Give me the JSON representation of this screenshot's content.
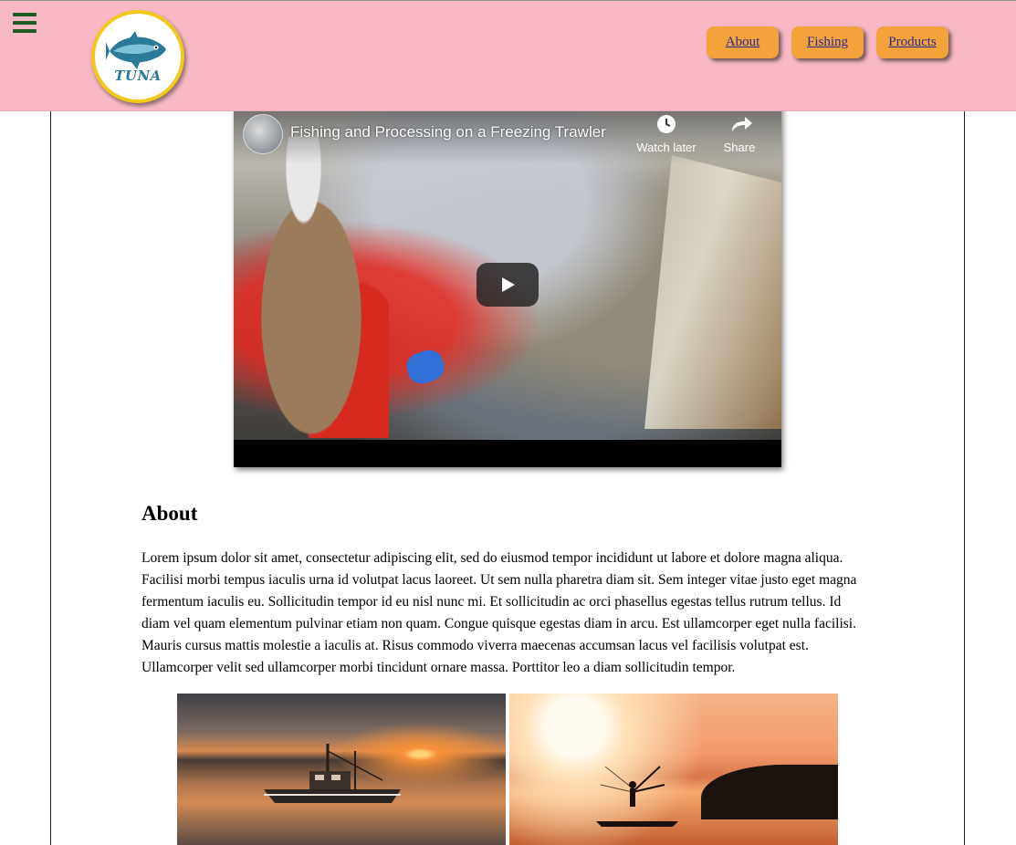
{
  "header": {
    "logo_text": "TUNA",
    "nav": [
      {
        "label": "About"
      },
      {
        "label": "Fishing"
      },
      {
        "label": "Products"
      }
    ]
  },
  "video": {
    "title": "Fishing and Processing on a Freezing Trawler",
    "watch_later_label": "Watch later",
    "share_label": "Share"
  },
  "about": {
    "heading": "About",
    "text": "Lorem ipsum dolor sit amet, consectetur adipiscing elit, sed do eiusmod tempor incididunt ut labore et dolore magna aliqua. Facilisi morbi tempus iaculis urna id volutpat lacus laoreet. Ut sem nulla pharetra diam sit. Sem integer vitae justo eget magna fermentum iaculis eu. Sollicitudin tempor id eu nisl nunc mi. Et sollicitudin ac orci phasellus egestas tellus rutrum tellus. Id diam vel quam elementum pulvinar etiam non quam. Congue quisque egestas diam in arcu. Est ullamcorper eget nulla facilisi. Mauris cursus mattis molestie a iaculis at. Risus commodo viverra maecenas accumsan lacus vel facilisis volutpat est. Ullamcorper velit sed ullamcorper morbi tincidunt ornare massa. Porttitor leo a diam sollicitudin tempor."
  },
  "colors": {
    "header_bg": "#f9b8c5",
    "nav_button_bg": "#f4a23a",
    "logo_ring": "#f2c81b",
    "hamburger": "#1f5a22"
  }
}
